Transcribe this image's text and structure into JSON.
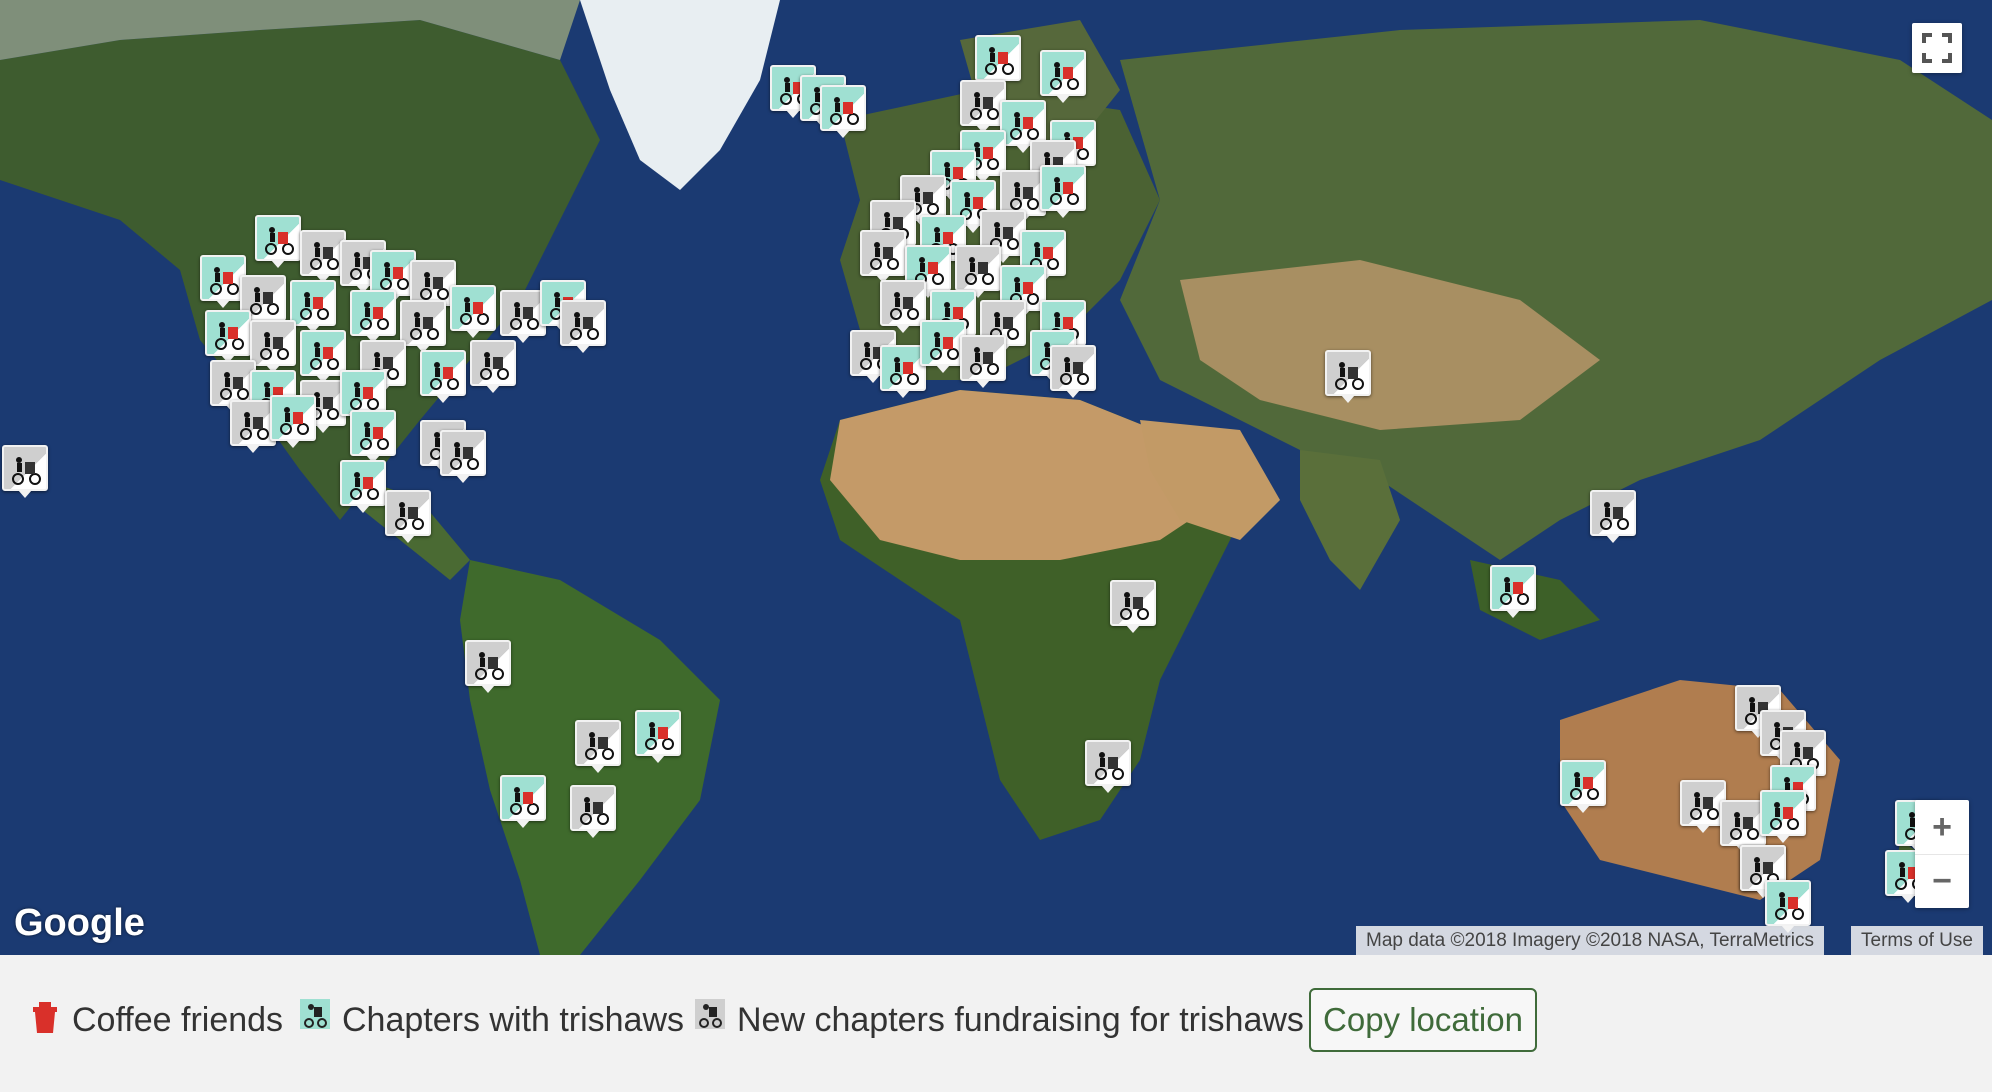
{
  "map": {
    "logo": "Google",
    "attribution": "Map data ©2018 Imagery ©2018 NASA, TerraMetrics",
    "terms": "Terms of Use",
    "controls": {
      "zoom_in": "+",
      "zoom_out": "−"
    },
    "colors": {
      "ocean": "#1b3a72",
      "land_green": "#3d5a2e",
      "desert": "#c49a68",
      "ice": "#e8eef2",
      "chapter_marker": "#9fe0d2",
      "fundraising_marker": "#cfcfcf",
      "coffee": "#d9302a"
    }
  },
  "legend": {
    "items": [
      {
        "label": "Coffee friends",
        "icon": "coffee-cup-icon"
      },
      {
        "label": "Chapters with trishaws",
        "icon": "trishaw-chapter-icon"
      },
      {
        "label": "New chapters fundraising for trishaws",
        "icon": "trishaw-fundraising-icon"
      }
    ],
    "copy_button": "Copy location"
  }
}
